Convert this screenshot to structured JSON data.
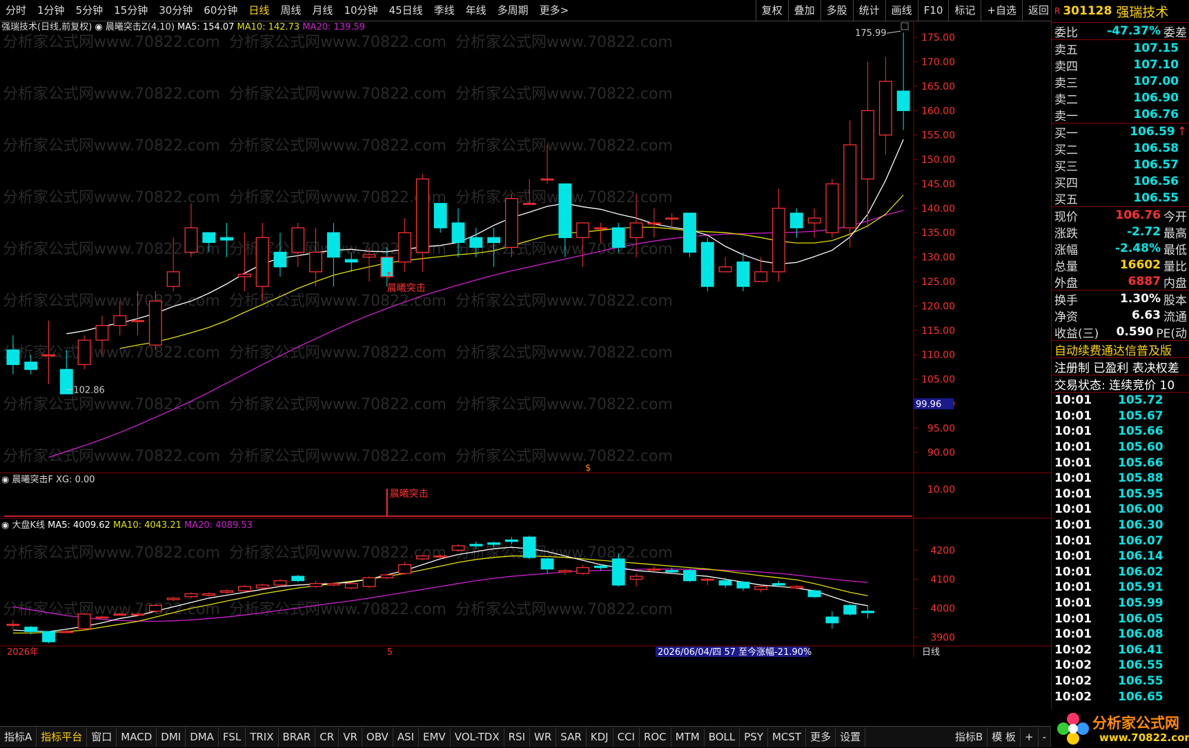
{
  "toolbar": {
    "periods": [
      "分时",
      "1分钟",
      "5分钟",
      "15分钟",
      "30分钟",
      "60分钟",
      "日线",
      "周线",
      "月线",
      "10分钟",
      "45日线",
      "季线",
      "年线",
      "多周期",
      "更多>"
    ],
    "active_period": "日线",
    "right_buttons": [
      "复权",
      "叠加",
      "多股",
      "统计",
      "画线",
      "F10",
      "标记",
      "+自选",
      "返回"
    ]
  },
  "main_legend": {
    "title": "强瑞技术(日线,前复权)",
    "indicator": "晨曦突击Z(4,10)",
    "ma5": "MA5: 154.07",
    "ma10": "MA10: 142.73",
    "ma20": "MA20: 139.59"
  },
  "sub_legend": {
    "title": "晨曦突击F",
    "xg": "XG: 0.00",
    "signal_label": "晨曦突击",
    "axis_value": "10.00"
  },
  "index_legend": {
    "title": "大盘K线",
    "ma5": "MA5: 4009.62",
    "ma10": "MA10: 4043.21",
    "ma20": "MA20: 4089.53"
  },
  "annotations": {
    "signal": "晨曦突击",
    "high": "175.99",
    "low": "102.86",
    "cursor_price": "99.96",
    "marker": "$"
  },
  "watermark": "分析家公式网www.70822.com",
  "date_axis": {
    "start": "2026年",
    "mid": "5",
    "info": "2026/06/04/四 57 至今涨幅-21.90%",
    "right": "日线"
  },
  "colors": {
    "up": "#ff3030",
    "down": "#00e6e6",
    "ma5": "#ffffff",
    "ma10": "#e0e000",
    "ma20": "#d020d0",
    "grid": "#8b0000"
  },
  "chart_data": {
    "type": "candlestick",
    "price_axis": {
      "ticks": [
        175,
        170,
        165,
        160,
        155,
        150,
        145,
        140,
        135,
        130,
        125,
        120,
        115,
        110,
        105,
        100,
        95,
        90
      ],
      "range": [
        86,
        177
      ]
    },
    "candles": [
      [
        111,
        108,
        114,
        106
      ],
      [
        108.5,
        107,
        110,
        106
      ],
      [
        110,
        110,
        117,
        104
      ],
      [
        107,
        102,
        111,
        102.9
      ],
      [
        108,
        113,
        114,
        107
      ],
      [
        113,
        116,
        118,
        110
      ],
      [
        116,
        118,
        121,
        114
      ],
      [
        117,
        117,
        123,
        114
      ],
      [
        112,
        121,
        123,
        111
      ],
      [
        124,
        127,
        134,
        123
      ],
      [
        131,
        136,
        141,
        130
      ],
      [
        135,
        133,
        135,
        131
      ],
      [
        134,
        133.5,
        137,
        130
      ],
      [
        126,
        126.5,
        135,
        123
      ],
      [
        124,
        134,
        137,
        121
      ],
      [
        131,
        128,
        135,
        126
      ],
      [
        131,
        136,
        137,
        128
      ],
      [
        127,
        131,
        136,
        124
      ],
      [
        135,
        130,
        137,
        124
      ],
      [
        129.5,
        129,
        131,
        127
      ],
      [
        130,
        130.5,
        132,
        125
      ],
      [
        130,
        126,
        132,
        124
      ],
      [
        129,
        135,
        138,
        127
      ],
      [
        131,
        146,
        147,
        127
      ],
      [
        141,
        136,
        141,
        135
      ],
      [
        137,
        133,
        140,
        130
      ],
      [
        134,
        132,
        136,
        130
      ],
      [
        134,
        133,
        136,
        128
      ],
      [
        132,
        142,
        143,
        130
      ],
      [
        141,
        141,
        146,
        141
      ],
      [
        146,
        146,
        153,
        145
      ],
      [
        145,
        134,
        145,
        130
      ],
      [
        134,
        137,
        137,
        128
      ],
      [
        136,
        136,
        137,
        133
      ],
      [
        136,
        132,
        137,
        131
      ],
      [
        134,
        137,
        143,
        130
      ],
      [
        137,
        137,
        140,
        134
      ],
      [
        138,
        138,
        139,
        136
      ],
      [
        139,
        131,
        139,
        130
      ],
      [
        133,
        124,
        134,
        123
      ],
      [
        127,
        128,
        130,
        127
      ],
      [
        129,
        124,
        131,
        123
      ],
      [
        125,
        127,
        130,
        125
      ],
      [
        127,
        140,
        144,
        125
      ],
      [
        139,
        136,
        140,
        134
      ],
      [
        137,
        138,
        140,
        134
      ],
      [
        135,
        145,
        146,
        134
      ],
      [
        136,
        153,
        158,
        132
      ],
      [
        146,
        160,
        170,
        136
      ],
      [
        155,
        166,
        171,
        151
      ],
      [
        164,
        160,
        175.99,
        156
      ]
    ],
    "ma5": [
      114.3,
      114.9,
      115.8,
      116.5,
      117.4,
      118.5,
      119.9,
      121.0,
      122.6,
      124.5,
      126.7,
      128.6,
      129.8,
      130.3,
      130.9,
      131.4,
      131.6,
      131.2,
      131.1,
      131.6,
      132.1,
      132.4,
      133.0,
      134.6,
      136.5,
      138.1,
      139.2,
      140.4,
      141.0,
      140.3,
      139.8,
      138.8,
      138.0,
      136.8,
      136.1,
      135.6,
      134.5,
      132.2,
      130.5,
      129.2,
      128.6,
      128.9,
      130.1,
      131.4,
      134.1,
      138.8,
      145.7,
      154.1
    ],
    "ma10": [
      111.3,
      112.0,
      112.6,
      113.5,
      114.5,
      115.6,
      117.0,
      118.7,
      120.3,
      121.9,
      123.6,
      125.0,
      126.3,
      127.2,
      128.0,
      128.8,
      129.3,
      129.7,
      130.1,
      130.5,
      130.8,
      131.3,
      132.3,
      133.4,
      134.4,
      134.9,
      135.1,
      135.5,
      135.9,
      136.1,
      136.1,
      135.8,
      135.4,
      135.2,
      135.0,
      134.6,
      134.0,
      133.3,
      132.9,
      132.9,
      133.4,
      134.7,
      136.4,
      138.8,
      142.7
    ],
    "ma20": [
      89.0,
      90.2,
      91.4,
      92.7,
      94.1,
      95.6,
      97.2,
      98.8,
      100.5,
      102.3,
      104.2,
      106.1,
      108.0,
      109.8,
      111.6,
      113.3,
      115.0,
      116.6,
      118.1,
      119.5,
      120.8,
      122.1,
      123.2,
      124.3,
      125.3,
      126.3,
      127.2,
      128.0,
      128.8,
      129.6,
      130.4,
      131.2,
      132.0,
      132.7,
      133.3,
      133.8,
      134.2,
      134.5,
      134.7,
      134.8,
      134.9,
      135.0,
      135.1,
      135.3,
      135.7,
      136.4,
      137.4,
      138.6,
      139.6
    ],
    "signal_index": 21,
    "index_axis": {
      "ticks": [
        4200,
        4100,
        4000,
        3900
      ],
      "range": [
        3885,
        4260
      ]
    },
    "index_candles": [
      [
        3945,
        3945,
        3960,
        3930
      ],
      [
        3935,
        3920,
        3940,
        3910
      ],
      [
        3920,
        3885,
        3922,
        3880
      ],
      [
        3920,
        3920,
        3925,
        3915
      ],
      [
        3930,
        3980,
        3985,
        3925
      ],
      [
        3970,
        3970,
        3975,
        3965
      ],
      [
        3980,
        3980,
        3985,
        3975
      ],
      [
        3980,
        3980,
        3985,
        3975
      ],
      [
        3990,
        4010,
        4015,
        3985
      ],
      [
        4030,
        4035,
        4040,
        4025
      ],
      [
        4040,
        4050,
        4055,
        4035
      ],
      [
        4045,
        4050,
        4055,
        4040
      ],
      [
        4055,
        4060,
        4065,
        4050
      ],
      [
        4060,
        4075,
        4080,
        4055
      ],
      [
        4070,
        4080,
        4085,
        4065
      ],
      [
        4080,
        4095,
        4100,
        4075
      ],
      [
        4110,
        4095,
        4115,
        4090
      ],
      [
        4075,
        4085,
        4095,
        4070
      ],
      [
        4080,
        4085,
        4090,
        4075
      ],
      [
        4070,
        4085,
        4090,
        4065
      ],
      [
        4075,
        4105,
        4110,
        4070
      ],
      [
        4105,
        4115,
        4120,
        4100
      ],
      [
        4120,
        4150,
        4160,
        4115
      ],
      [
        4170,
        4180,
        4185,
        4165
      ],
      [
        4180,
        4180,
        4185,
        4170
      ],
      [
        4200,
        4215,
        4220,
        4195
      ],
      [
        4220,
        4215,
        4230,
        4205
      ],
      [
        4225,
        4220,
        4230,
        4210
      ],
      [
        4235,
        4230,
        4245,
        4220
      ],
      [
        4245,
        4175,
        4250,
        4170
      ],
      [
        4170,
        4135,
        4175,
        4120
      ],
      [
        4125,
        4130,
        4135,
        4115
      ],
      [
        4120,
        4140,
        4150,
        4115
      ],
      [
        4145,
        4140,
        4150,
        4130
      ],
      [
        4170,
        4080,
        4190,
        4075
      ],
      [
        4100,
        4110,
        4120,
        4075
      ],
      [
        4135,
        4135,
        4145,
        4125
      ],
      [
        4130,
        4125,
        4140,
        4120
      ],
      [
        4130,
        4095,
        4135,
        4090
      ],
      [
        4100,
        4100,
        4105,
        4080
      ],
      [
        4095,
        4080,
        4105,
        4070
      ],
      [
        4090,
        4070,
        4095,
        4060
      ],
      [
        4065,
        4075,
        4080,
        4055
      ],
      [
        4085,
        4080,
        4095,
        4075
      ],
      [
        4070,
        4075,
        4080,
        4065
      ],
      [
        4060,
        4040,
        4065,
        4035
      ],
      [
        3970,
        3950,
        3990,
        3930
      ],
      [
        4010,
        3980,
        4015,
        3975
      ],
      [
        3990,
        3985,
        4010,
        3965
      ]
    ],
    "index_ma5": [
      3925,
      3922,
      3920,
      3928,
      3938,
      3950,
      3965,
      3975,
      3990,
      4005,
      4020,
      4035,
      4045,
      4055,
      4065,
      4075,
      4080,
      4083,
      4085,
      4090,
      4100,
      4115,
      4130,
      4150,
      4170,
      4185,
      4195,
      4205,
      4210,
      4205,
      4195,
      4180,
      4165,
      4150,
      4140,
      4130,
      4125,
      4120,
      4115,
      4110,
      4100,
      4090,
      4080,
      4075,
      4070,
      4060,
      4040,
      4020,
      4009
    ],
    "index_ma10": [
      3915,
      3915,
      3917,
      3920,
      3925,
      3935,
      3945,
      3955,
      3970,
      3985,
      4000,
      4012,
      4025,
      4037,
      4050,
      4060,
      4070,
      4077,
      4085,
      4093,
      4100,
      4110,
      4120,
      4132,
      4145,
      4158,
      4168,
      4175,
      4180,
      4180,
      4178,
      4175,
      4170,
      4165,
      4160,
      4155,
      4150,
      4145,
      4140,
      4135,
      4128,
      4120,
      4112,
      4105,
      4098,
      4085,
      4070,
      4055,
      4043
    ],
    "index_ma20": [
      4005,
      3995,
      3985,
      3975,
      3968,
      3962,
      3958,
      3956,
      3955,
      3957,
      3960,
      3965,
      3970,
      3977,
      3985,
      3993,
      4001,
      4010,
      4018,
      4026,
      4035,
      4045,
      4055,
      4065,
      4075,
      4085,
      4095,
      4103,
      4110,
      4115,
      4120,
      4125,
      4128,
      4130,
      4132,
      4134,
      4135,
      4135,
      4134,
      4133,
      4131,
      4128,
      4125,
      4120,
      4114,
      4107,
      4100,
      4094,
      4089
    ]
  },
  "side": {
    "r_flag": "R",
    "code": "301128",
    "name": "强瑞技术",
    "weibi": {
      "label": "委比",
      "value": "-47.37%",
      "label2": "委差"
    },
    "asks": [
      {
        "label": "卖五",
        "price": "107.15"
      },
      {
        "label": "卖四",
        "price": "107.10"
      },
      {
        "label": "卖三",
        "price": "107.00"
      },
      {
        "label": "卖二",
        "price": "106.90"
      },
      {
        "label": "卖一",
        "price": "106.76"
      }
    ],
    "bids": [
      {
        "label": "买一",
        "price": "106.59",
        "arrow": "↑"
      },
      {
        "label": "买二",
        "price": "106.58"
      },
      {
        "label": "买三",
        "price": "106.57"
      },
      {
        "label": "买四",
        "price": "106.56"
      },
      {
        "label": "买五",
        "price": "106.55"
      }
    ],
    "stats": [
      {
        "label": "现价",
        "value": "106.76",
        "label2": "今开",
        "cls": "red"
      },
      {
        "label": "涨跌",
        "value": "-2.72",
        "label2": "最高",
        "cls": "green"
      },
      {
        "label": "涨幅",
        "value": "-2.48%",
        "label2": "最低",
        "cls": "green"
      },
      {
        "label": "总量",
        "value": "16602",
        "label2": "量比",
        "cls": "yellow"
      },
      {
        "label": "外盘",
        "value": "6887",
        "label2": "内盘",
        "cls": "red"
      }
    ],
    "stats2": [
      {
        "label": "换手",
        "value": "1.30%",
        "label2": "股本",
        "cls": "white"
      },
      {
        "label": "净资",
        "value": "6.63",
        "label2": "流通",
        "cls": "white"
      },
      {
        "label": "收益(三)",
        "value": "0.590",
        "label2": "PE(动",
        "cls": "white"
      }
    ],
    "notice": "自动续费通达信普及版",
    "reg": "注册制 已盈利 表决权差",
    "status": "交易状态: 连续竞价 10",
    "ticks": [
      {
        "t": "10:01",
        "p": "105.72"
      },
      {
        "t": "10:01",
        "p": "105.67"
      },
      {
        "t": "10:01",
        "p": "105.66"
      },
      {
        "t": "10:01",
        "p": "105.60"
      },
      {
        "t": "10:01",
        "p": "105.66"
      },
      {
        "t": "10:01",
        "p": "105.88"
      },
      {
        "t": "10:01",
        "p": "105.95"
      },
      {
        "t": "10:01",
        "p": "106.00"
      },
      {
        "t": "10:01",
        "p": "106.30"
      },
      {
        "t": "10:01",
        "p": "106.07"
      },
      {
        "t": "10:01",
        "p": "106.14"
      },
      {
        "t": "10:01",
        "p": "106.02"
      },
      {
        "t": "10:01",
        "p": "105.91"
      },
      {
        "t": "10:01",
        "p": "105.99"
      },
      {
        "t": "10:01",
        "p": "106.05"
      },
      {
        "t": "10:01",
        "p": "106.08"
      },
      {
        "t": "10:02",
        "p": "106.41"
      },
      {
        "t": "10:02",
        "p": "106.55"
      },
      {
        "t": "10:02",
        "p": "106.55"
      },
      {
        "t": "10:02",
        "p": "106.65"
      }
    ]
  },
  "bottom_tabs": [
    "指标A",
    "指标平台",
    "窗口",
    "MACD",
    "DMI",
    "DMA",
    "FSL",
    "TRIX",
    "BRAR",
    "CR",
    "VR",
    "OBV",
    "ASI",
    "EMV",
    "VOL-TDX",
    "RSI",
    "WR",
    "SAR",
    "KDJ",
    "CCI",
    "ROC",
    "MTM",
    "BOLL",
    "PSY",
    "MCST",
    "更多",
    "设置"
  ],
  "bottom_right_tabs": [
    "指标B",
    "模 板",
    "+",
    "-"
  ],
  "logo": {
    "line1": "分析家公式网",
    "line2": "www.70822.com"
  }
}
